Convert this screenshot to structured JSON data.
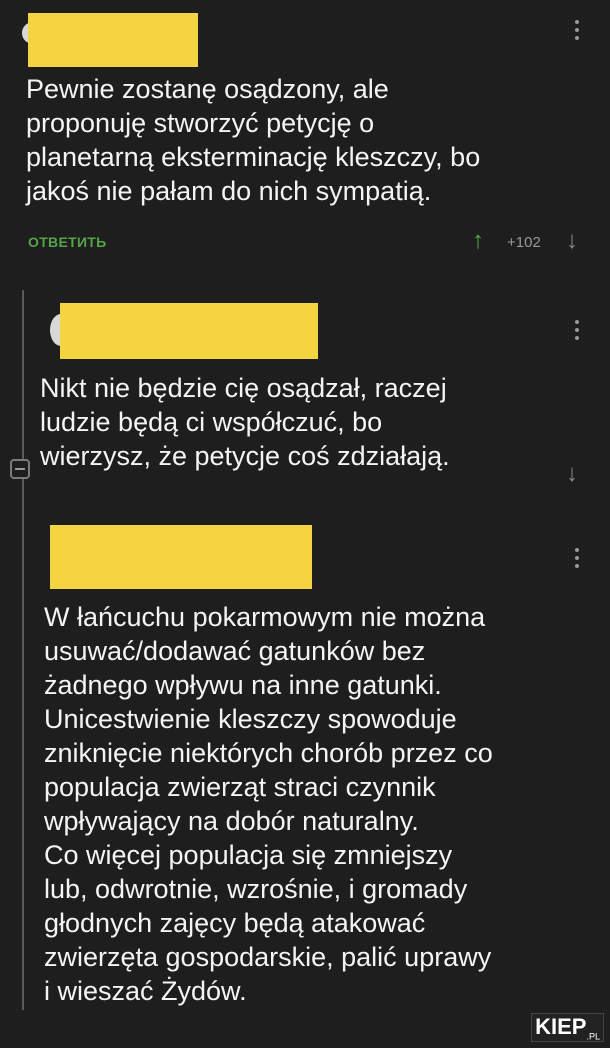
{
  "comments": [
    {
      "body": "Pewnie zostanę osądzony, ale\nproponuję stworzyć petycję o\nplanetarną eksterminację kleszczy, bo\njakoś nie pałam do nich sympatią.",
      "reply_label": "ОТВЕТИТЬ",
      "score": "+102"
    },
    {
      "body": "Nikt nie będzie cię osądzał, raczej\nludzie będą ci współczuć, bo\nwierzysz, że petycje coś zdziałają."
    },
    {
      "body": "W łańcuchu pokarmowym nie można\nusuwać/dodawać gatunków bez\nżadnego wpływu na inne gatunki.\nUnicestwienie kleszczy spowoduje\nzniknięcie niektórych chorób przez co\npopulacja zwierząt straci czynnik\nwpływający na dobór naturalny.\nCo więcej populacja się zmniejszy\nlub, odwrotnie, wzrośnie, i gromady\ngłodnych zajęcy będą atakować\nzwierzęta gospodarskie, palić uprawy\ni wieszać Żydów."
    }
  ],
  "icons": {
    "upvote": "↑",
    "downvote": "↓"
  },
  "watermark": {
    "main": "KIEP",
    "suffix": ".PL"
  },
  "colors": {
    "redaction": "#f5d442",
    "upvote": "#57a34a",
    "background": "#1e1e1e"
  }
}
